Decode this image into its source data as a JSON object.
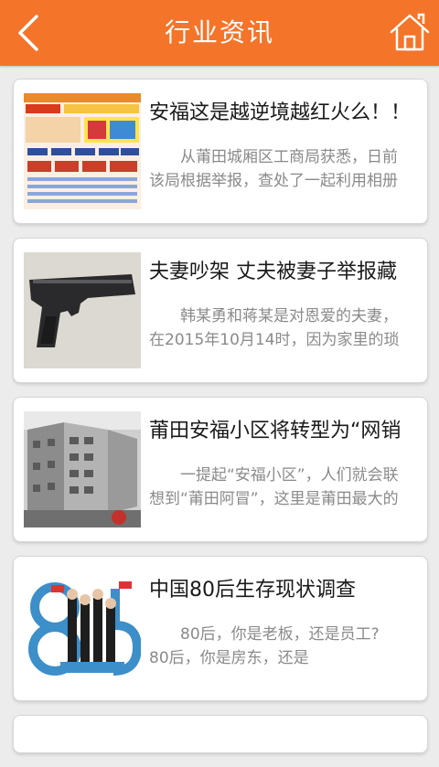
{
  "header": {
    "title": "行业资讯",
    "back_icon": "chevron-left-icon",
    "home_icon": "home-icon",
    "bg_color": "#f4742a"
  },
  "articles": [
    {
      "title": "安福这是越逆境越红火么！！",
      "summary": "从莆田城厢区工商局获悉，日前该局根据举报，查处了一起利用相册"
    },
    {
      "title": "夫妻吵架 丈夫被妻子举报藏",
      "summary": "韩某勇和蒋某是对恩爱的夫妻，在2015年10月14时，因为家里的琐"
    },
    {
      "title": "莆田安福小区将转型为“网销",
      "summary": "一提起“安福小区”，人们就会联想到“莆田阿冒”，这里是莆田最大的"
    },
    {
      "title": "中国80后生存现状调查",
      "summary": "80后，你是老板，还是员工?　　　　80后，你是房东，还是"
    }
  ]
}
